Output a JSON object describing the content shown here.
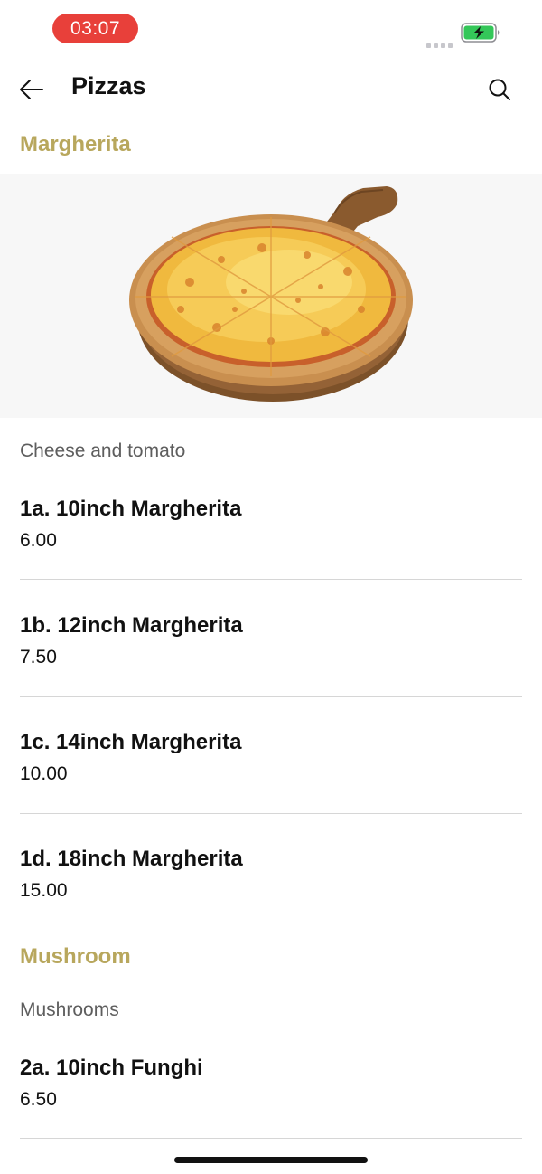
{
  "status_bar": {
    "time": "03:07",
    "time_pill_color": "#e8403a",
    "battery_color": "#34c759",
    "battery_state": "charging"
  },
  "header": {
    "title": "Pizzas",
    "back_icon": "arrow-left-icon",
    "search_icon": "search-icon"
  },
  "sections": [
    {
      "title": "Margherita",
      "has_image": true,
      "description": "Cheese and tomato",
      "items": [
        {
          "name": "1a. 10inch Margherita",
          "price": "6.00"
        },
        {
          "name": "1b. 12inch Margherita",
          "price": "7.50"
        },
        {
          "name": "1c. 14inch Margherita",
          "price": "10.00"
        },
        {
          "name": "1d. 18inch Margherita",
          "price": "15.00"
        }
      ]
    },
    {
      "title": "Mushroom",
      "description": "Mushrooms",
      "items": [
        {
          "name": "2a. 10inch Funghi",
          "price": "6.50"
        }
      ]
    }
  ],
  "colors": {
    "accent": "#b8a75d",
    "text": "#111111",
    "muted_text": "#5e5e5e",
    "divider": "#d6d6d6"
  }
}
